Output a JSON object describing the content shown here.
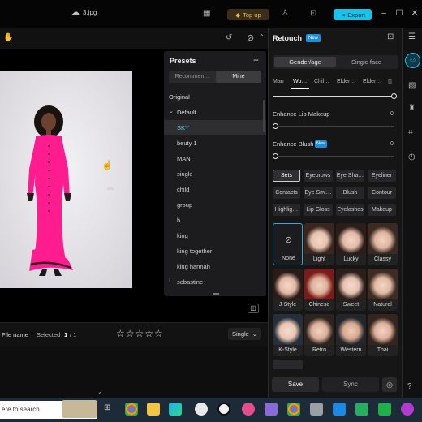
{
  "titlebar": {
    "file_name": "3.jpg",
    "topup_label": "Top up",
    "export_label": "Export"
  },
  "presets": {
    "title": "Presets",
    "tabs": [
      "Recommen…",
      "Mine"
    ],
    "original": "Original",
    "folder": "Default",
    "items": [
      "SKY",
      "beuty 1",
      "MAN",
      "single",
      "child",
      "group",
      "h",
      "king",
      "king together",
      "king hannah"
    ],
    "sub_folder": "sebastine"
  },
  "bottombar": {
    "file_name_label": "File name",
    "selected_label": "Selected",
    "selected_count": "1",
    "selected_total": "/ 1",
    "rating_stars": "☆☆☆☆☆",
    "view_mode": "Single"
  },
  "panel": {
    "title": "Retouch",
    "badge": "New",
    "modes": [
      "Gender/age",
      "Single face"
    ],
    "filters": [
      "Man",
      "Wo…",
      "Chil…",
      "Elder…",
      "Elder…"
    ],
    "lip": {
      "label": "Enhance Lip Makeup",
      "value": "0"
    },
    "blush": {
      "label": "Enhance Blush",
      "badge": "New",
      "value": "0"
    },
    "chips": [
      "Sets",
      "Eyebrows",
      "Eye Sha…",
      "Eyeliner",
      "Contacts",
      "Eye Smi…",
      "Blush",
      "Contour",
      "Highlig…",
      "Lip Gloss",
      "Eyelashes",
      "Makeup"
    ],
    "styles": [
      "None",
      "Light",
      "Lucky",
      "Classy",
      "J-Style",
      "Chinese",
      "Sweet",
      "Natural",
      "K-Style",
      "Retro",
      "Western",
      "Thai"
    ],
    "save_label": "Save",
    "sync_label": "Sync"
  },
  "taskbar": {
    "search_text": "ere to search"
  },
  "colors": {
    "accent": "#16c3ea",
    "topup": "#e8b84a",
    "dress": "#ff1c8e"
  }
}
